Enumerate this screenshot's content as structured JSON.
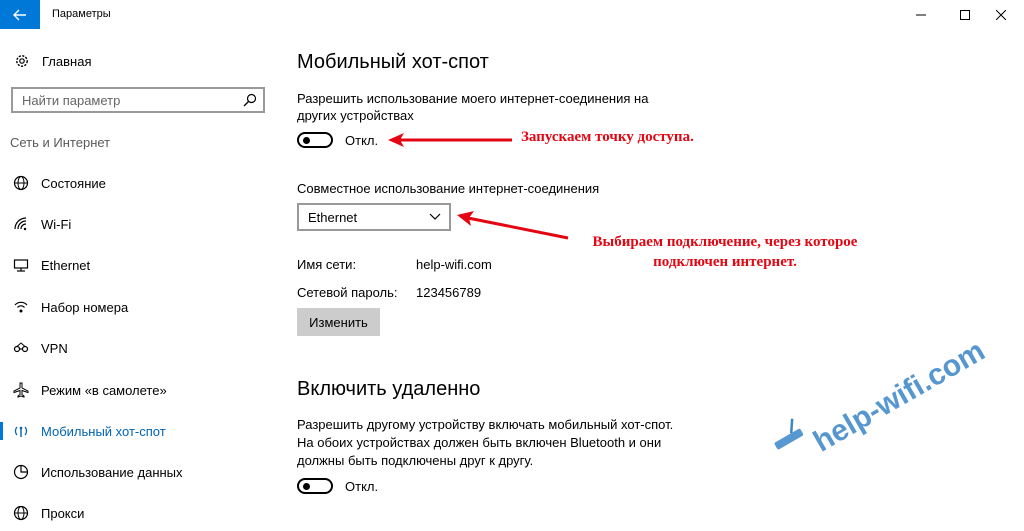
{
  "window": {
    "title": "Параметры"
  },
  "sidebar": {
    "home_label": "Главная",
    "search_placeholder": "Найти параметр",
    "section_title": "Сеть и Интернет",
    "items": [
      {
        "label": "Состояние",
        "icon": "globe-icon"
      },
      {
        "label": "Wi-Fi",
        "icon": "wifi-icon"
      },
      {
        "label": "Ethernet",
        "icon": "ethernet-icon"
      },
      {
        "label": "Набор номера",
        "icon": "dialup-icon"
      },
      {
        "label": "VPN",
        "icon": "vpn-icon"
      },
      {
        "label": "Режим «в самолете»",
        "icon": "airplane-icon"
      },
      {
        "label": "Мобильный хот-спот",
        "icon": "hotspot-icon",
        "active": true
      },
      {
        "label": "Использование данных",
        "icon": "data-usage-icon"
      },
      {
        "label": "Прокси",
        "icon": "proxy-globe-icon"
      }
    ]
  },
  "main": {
    "hotspot_title": "Мобильный хот-спот",
    "share_desc_line1": "Разрешить использование моего интернет-соединения на",
    "share_desc_line2": "других устройствах",
    "share_toggle_state": "Откл.",
    "connection_label": "Совместное использование интернет-соединения",
    "connection_value": "Ethernet",
    "network_name_label": "Имя сети:",
    "network_name_value": "help-wifi.com",
    "password_label": "Сетевой пароль:",
    "password_value": "123456789",
    "change_button": "Изменить",
    "remote_title": "Включить удаленно",
    "remote_desc_line1": "Разрешить другому устройству включать мобильный хот-спот.",
    "remote_desc_line2": "На обоих устройствах должен быть включен Bluetooth и они",
    "remote_desc_line3": "должны быть подключены друг к другу.",
    "remote_toggle_state": "Откл."
  },
  "annotations": {
    "note1": "Запускаем точку доступа.",
    "note2_line1": "Выбираем подключение, через которое",
    "note2_line2": "подключен интернет.",
    "color": "#e30613"
  },
  "watermark": {
    "text": "help-wifi.com",
    "color": "#3a86c8"
  },
  "colors": {
    "accent": "#0078d7",
    "active_text": "#0063b1"
  }
}
